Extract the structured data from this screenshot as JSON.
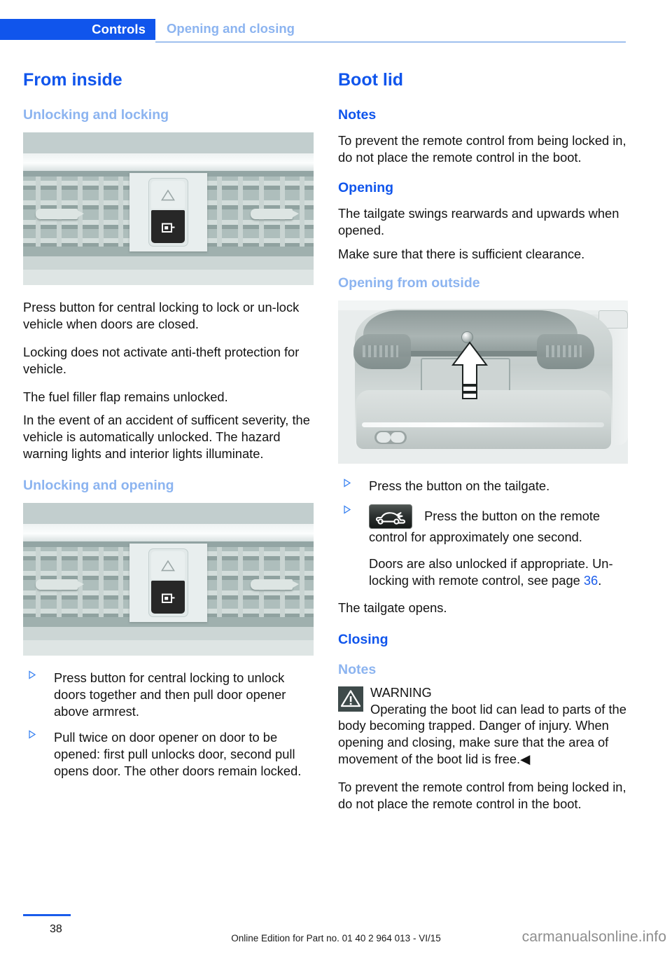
{
  "header": {
    "tab_label": "Controls",
    "section_label": "Opening and closing"
  },
  "left_column": {
    "title": "From inside",
    "section_1": {
      "heading": "Unlocking and locking",
      "figure_alt": "centre-console-vents-with-central-locking-button",
      "paragraphs": [
        "Press button for central locking to lock or un-lock vehicle when doors are closed.",
        "Locking does not activate anti-theft protection for vehicle.",
        "The fuel filler flap remains unlocked.",
        "In the event of an accident of sufficent severity, the vehicle is automatically unlocked. The hazard warning lights and interior lights illuminate."
      ]
    },
    "section_2": {
      "heading": "Unlocking and opening",
      "figure_alt": "centre-console-vents-with-central-locking-button",
      "bullets": [
        "Press button for central locking to unlock doors together and then pull door opener above armrest.",
        "Pull twice on door opener on door to be opened: first pull unlocks door, second pull opens door. The other doors remain locked."
      ]
    }
  },
  "right_column": {
    "title": "Boot lid",
    "notes_heading": "Notes",
    "notes_text": "To prevent the remote control from being locked in, do not place the remote control in the boot.",
    "opening_heading": "Opening",
    "opening_paragraphs": [
      "The tailgate swings rearwards and upwards when opened.",
      "Make sure that there is sufficient clearance."
    ],
    "opening_outside_heading": "Opening from outside",
    "figure_alt": "rear-of-vehicle-tailgate-button-arrow",
    "bullet_1": "Press the button on the tailgate.",
    "bullet_2_icon": "remote-control-boot-icon",
    "bullet_2_text": "Press the button on the remote control for approximately one second.",
    "bullet_2_note_pre": "Doors are also unlocked if appropriate. Un-locking with remote control, see page ",
    "bullet_2_note_link": "36",
    "bullet_2_note_post": ".",
    "tailgate_opens": "The tailgate opens.",
    "closing_heading": "Closing",
    "closing_notes_heading": "Notes",
    "warning_label": "WARNING",
    "warning_text": "Operating the boot lid can lead to parts of the body becoming trapped. Danger of injury. When opening and closing, make sure that the area of movement of the boot lid is free.◀",
    "closing_notes_text": "To prevent the remote control from being locked in, do not place the remote control in the boot."
  },
  "footer": {
    "page_number": "38",
    "edition_text": "Online Edition for Part no. 01 40 2 964 013 - VI/15",
    "watermark": "carmanualsonline.info"
  },
  "colors": {
    "accent_blue": "#1055ec",
    "light_blue": "#8cb4f0",
    "link_blue": "#1a5ceb"
  }
}
